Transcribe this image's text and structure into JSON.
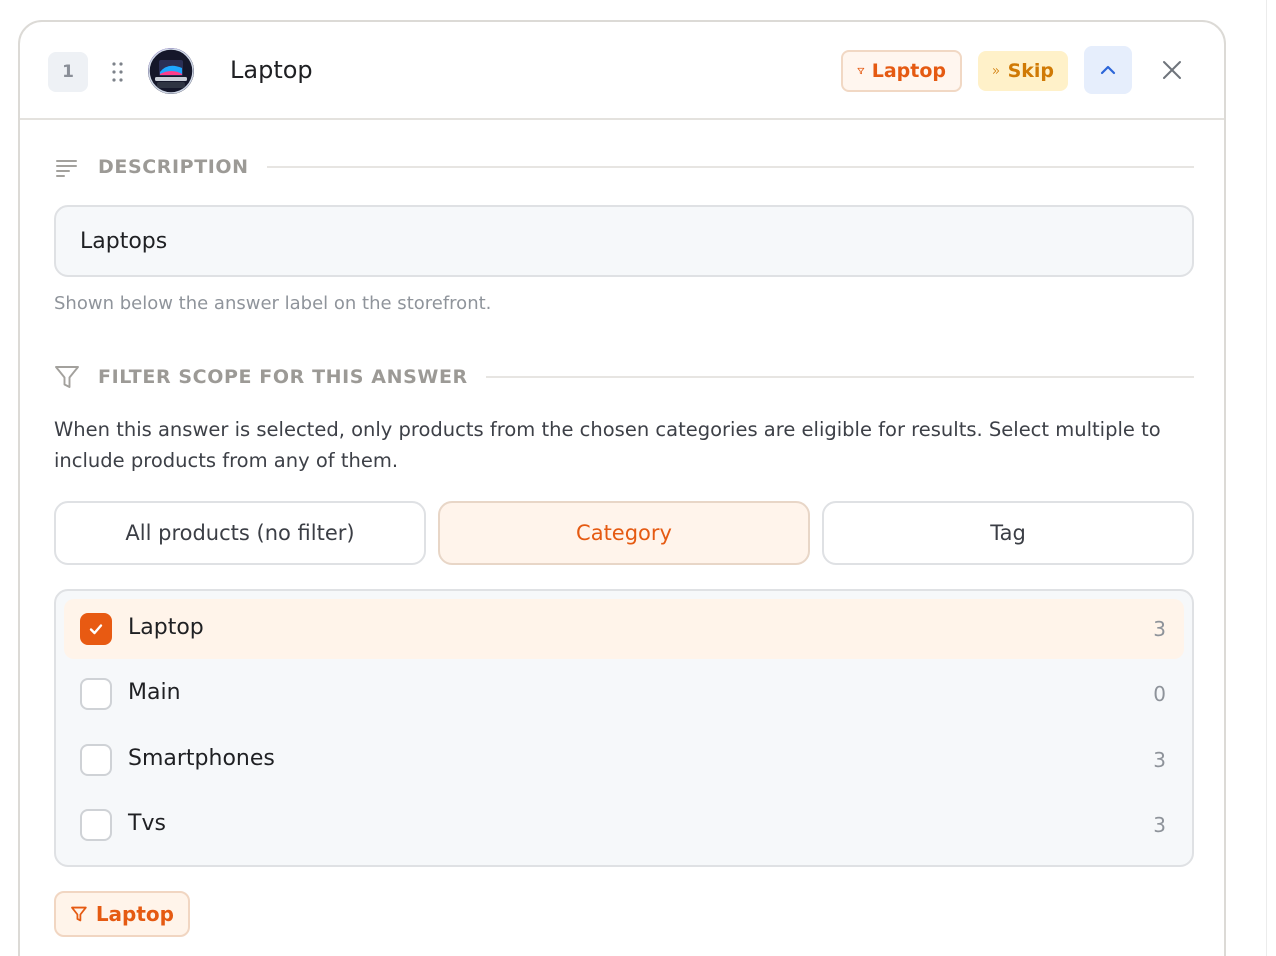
{
  "header": {
    "order": "1",
    "title": "Laptop",
    "filter_pill": "Laptop",
    "skip_pill": "Skip"
  },
  "description": {
    "section_label": "DESCRIPTION",
    "value": "Laptops",
    "hint": "Shown below the answer label on the storefront."
  },
  "filter_scope": {
    "section_label": "FILTER SCOPE FOR THIS ANSWER",
    "description": "When this answer is selected, only products from the chosen categories are eligible for results. Select multiple to include products from any of them.",
    "modes": [
      {
        "label": "All products (no filter)",
        "active": false
      },
      {
        "label": "Category",
        "active": true
      },
      {
        "label": "Tag",
        "active": false
      }
    ],
    "categories": [
      {
        "name": "Laptop",
        "count": "3",
        "checked": true
      },
      {
        "name": "Main",
        "count": "0",
        "checked": false
      },
      {
        "name": "Smartphones",
        "count": "3",
        "checked": false
      },
      {
        "name": "Tvs",
        "count": "3",
        "checked": false
      }
    ],
    "selected_chip": "Laptop"
  },
  "colors": {
    "accent": "#e85a12",
    "accent_bg": "#fff4ea",
    "skip_bg": "#fff1c9",
    "skip_text": "#d07a05",
    "collapse_bg": "#e6eefc"
  },
  "icons": {
    "description": "lines-icon",
    "filter": "funnel-icon",
    "skip": "double-chevron-right-icon",
    "collapse": "chevron-up-icon",
    "close": "close-icon",
    "drag": "drag-handle-icon"
  }
}
